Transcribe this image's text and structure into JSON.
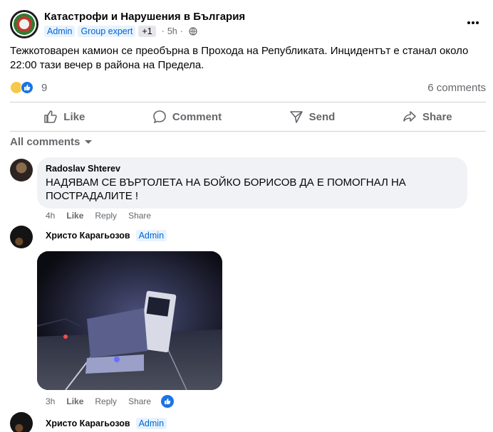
{
  "post": {
    "group_name": "Катастрофи и Нарушения в България",
    "badges": [
      "Admin",
      "Group expert"
    ],
    "extra_badge": "+1",
    "time": "5h",
    "text": "Тежкотоварен камион се преобърна в Прохода на Републиката. Инцидентът е станал около 22:00 тази вечер в района на Предела.",
    "reaction_count": "9",
    "comment_count": "6 comments"
  },
  "actions": {
    "like": "Like",
    "comment": "Comment",
    "send": "Send",
    "share": "Share"
  },
  "comments_filter": "All comments",
  "comments": [
    {
      "author": "Radoslav Shterev",
      "text": "НАДЯВАМ СЕ ВЪРТОЛЕТА НА БОЙКО БОРИСОВ ДА Е ПОМОГНАЛ НА ПОСТРАДАЛИТЕ !",
      "time": "4h",
      "like": "Like",
      "reply": "Reply",
      "share": "Share"
    },
    {
      "author": "Христо Карагьозов",
      "badge": "Admin",
      "time": "3h",
      "like": "Like",
      "reply": "Reply",
      "share": "Share"
    },
    {
      "author": "Христо Карагьозов",
      "badge": "Admin"
    }
  ],
  "colors": {
    "accent": "#1b74e4",
    "badge_bg": "#e7f3ff",
    "badge_text": "#0064d1",
    "muted": "#65676b",
    "bubble": "#f0f2f5"
  },
  "icons": [
    "globe-icon",
    "more-icon",
    "like-icon",
    "comment-icon",
    "send-icon",
    "share-icon",
    "chevron-down-icon"
  ]
}
